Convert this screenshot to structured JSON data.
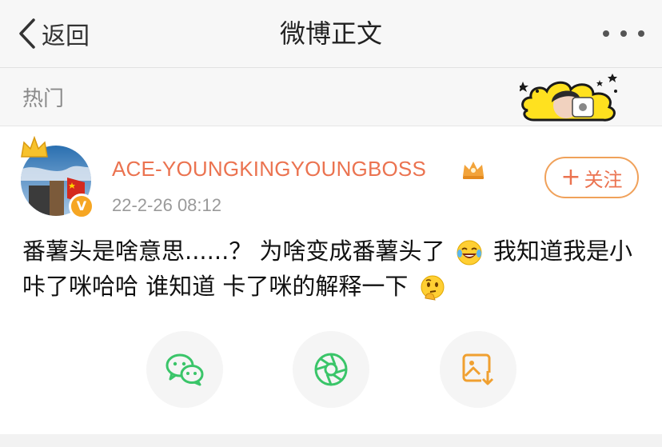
{
  "nav": {
    "back_label": "返回",
    "title": "微博正文"
  },
  "hot": {
    "label": "热门"
  },
  "post": {
    "username": "ACE-YOUNGKINGYOUNGBOSS",
    "timestamp": "22-2-26 08:12",
    "follow_label": "关注",
    "verified_badge": "V",
    "text_part1": "番薯头是啥意思......？ 为啥变成番薯头了",
    "text_part2": " 我知道我是小咔了咪哈哈 谁知道 卡了咪的解释一下"
  },
  "icons": {
    "back": "chevron-left-icon",
    "more": "more-dots-icon",
    "wechat": "wechat-icon",
    "moments": "moments-icon",
    "save": "save-image-icon",
    "laugh": "laughing-crying-emoji",
    "thinking": "thinking-emoji"
  },
  "colors": {
    "username": "#eb7350",
    "follow_border": "#f0a15a",
    "wechat": "#3ac569",
    "save": "#f0a030",
    "nav_bg": "#f7f7f7"
  }
}
